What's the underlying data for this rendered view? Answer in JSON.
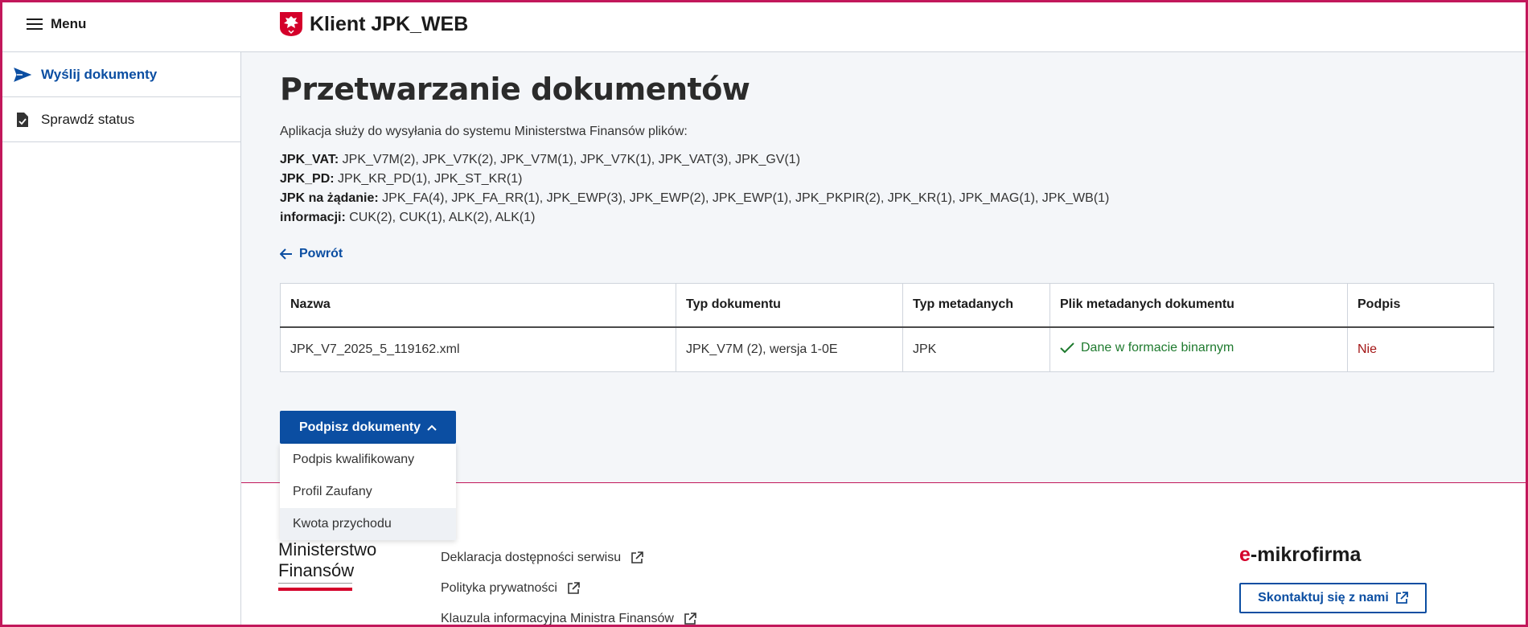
{
  "header": {
    "menu_label": "Menu",
    "app_title": "Klient JPK_WEB"
  },
  "sidebar": {
    "items": [
      {
        "label": "Wyślij dokumenty",
        "icon": "send-icon",
        "active": true
      },
      {
        "label": "Sprawdź status",
        "icon": "document-check-icon",
        "active": false
      }
    ]
  },
  "main": {
    "title": "Przetwarzanie dokumentów",
    "intro": "Aplikacja służy do wysyłania do systemu Ministerstwa Finansów plików:",
    "types": [
      {
        "label": "JPK_VAT:",
        "value": " JPK_V7M(2), JPK_V7K(2), JPK_V7M(1), JPK_V7K(1), JPK_VAT(3), JPK_GV(1)"
      },
      {
        "label": "JPK_PD:",
        "value": " JPK_KR_PD(1), JPK_ST_KR(1)"
      },
      {
        "label": "JPK na żądanie:",
        "value": " JPK_FA(4), JPK_FA_RR(1), JPK_EWP(3), JPK_EWP(2), JPK_EWP(1), JPK_PKPIR(2), JPK_KR(1), JPK_MAG(1), JPK_WB(1)"
      },
      {
        "label": "informacji:",
        "value": " CUK(2), CUK(1), ALK(2), ALK(1)"
      }
    ],
    "back_label": "Powrót",
    "table": {
      "headers": [
        "Nazwa",
        "Typ dokumentu",
        "Typ metadanych",
        "Plik metadanych dokumentu",
        "Podpis"
      ],
      "rows": [
        {
          "name": "JPK_V7_2025_5_119162.xml",
          "doc_type": "JPK_V7M (2), wersja 1-0E",
          "meta_type": "JPK",
          "meta_file": "Dane w formacie binarnym",
          "signature": "Nie"
        }
      ]
    },
    "sign_button": "Podpisz dokumenty",
    "sign_options": [
      "Podpis kwalifikowany",
      "Profil Zaufany",
      "Kwota przychodu"
    ]
  },
  "footer": {
    "ministry_line1": "Ministerstwo",
    "ministry_line2": "Finansów",
    "links": [
      "Deklaracja dostępności serwisu",
      "Polityka prywatności",
      "Klauzula informacyjna Ministra Finansów"
    ],
    "brand_e": "e",
    "brand_rest": "-mikrofirma",
    "contact_label": "Skontaktuj się z nami"
  },
  "colors": {
    "accent": "#0b4ea2",
    "frame": "#c2185b",
    "success": "#1e7a2e",
    "danger": "#a31515",
    "brand_red": "#d4002a"
  }
}
